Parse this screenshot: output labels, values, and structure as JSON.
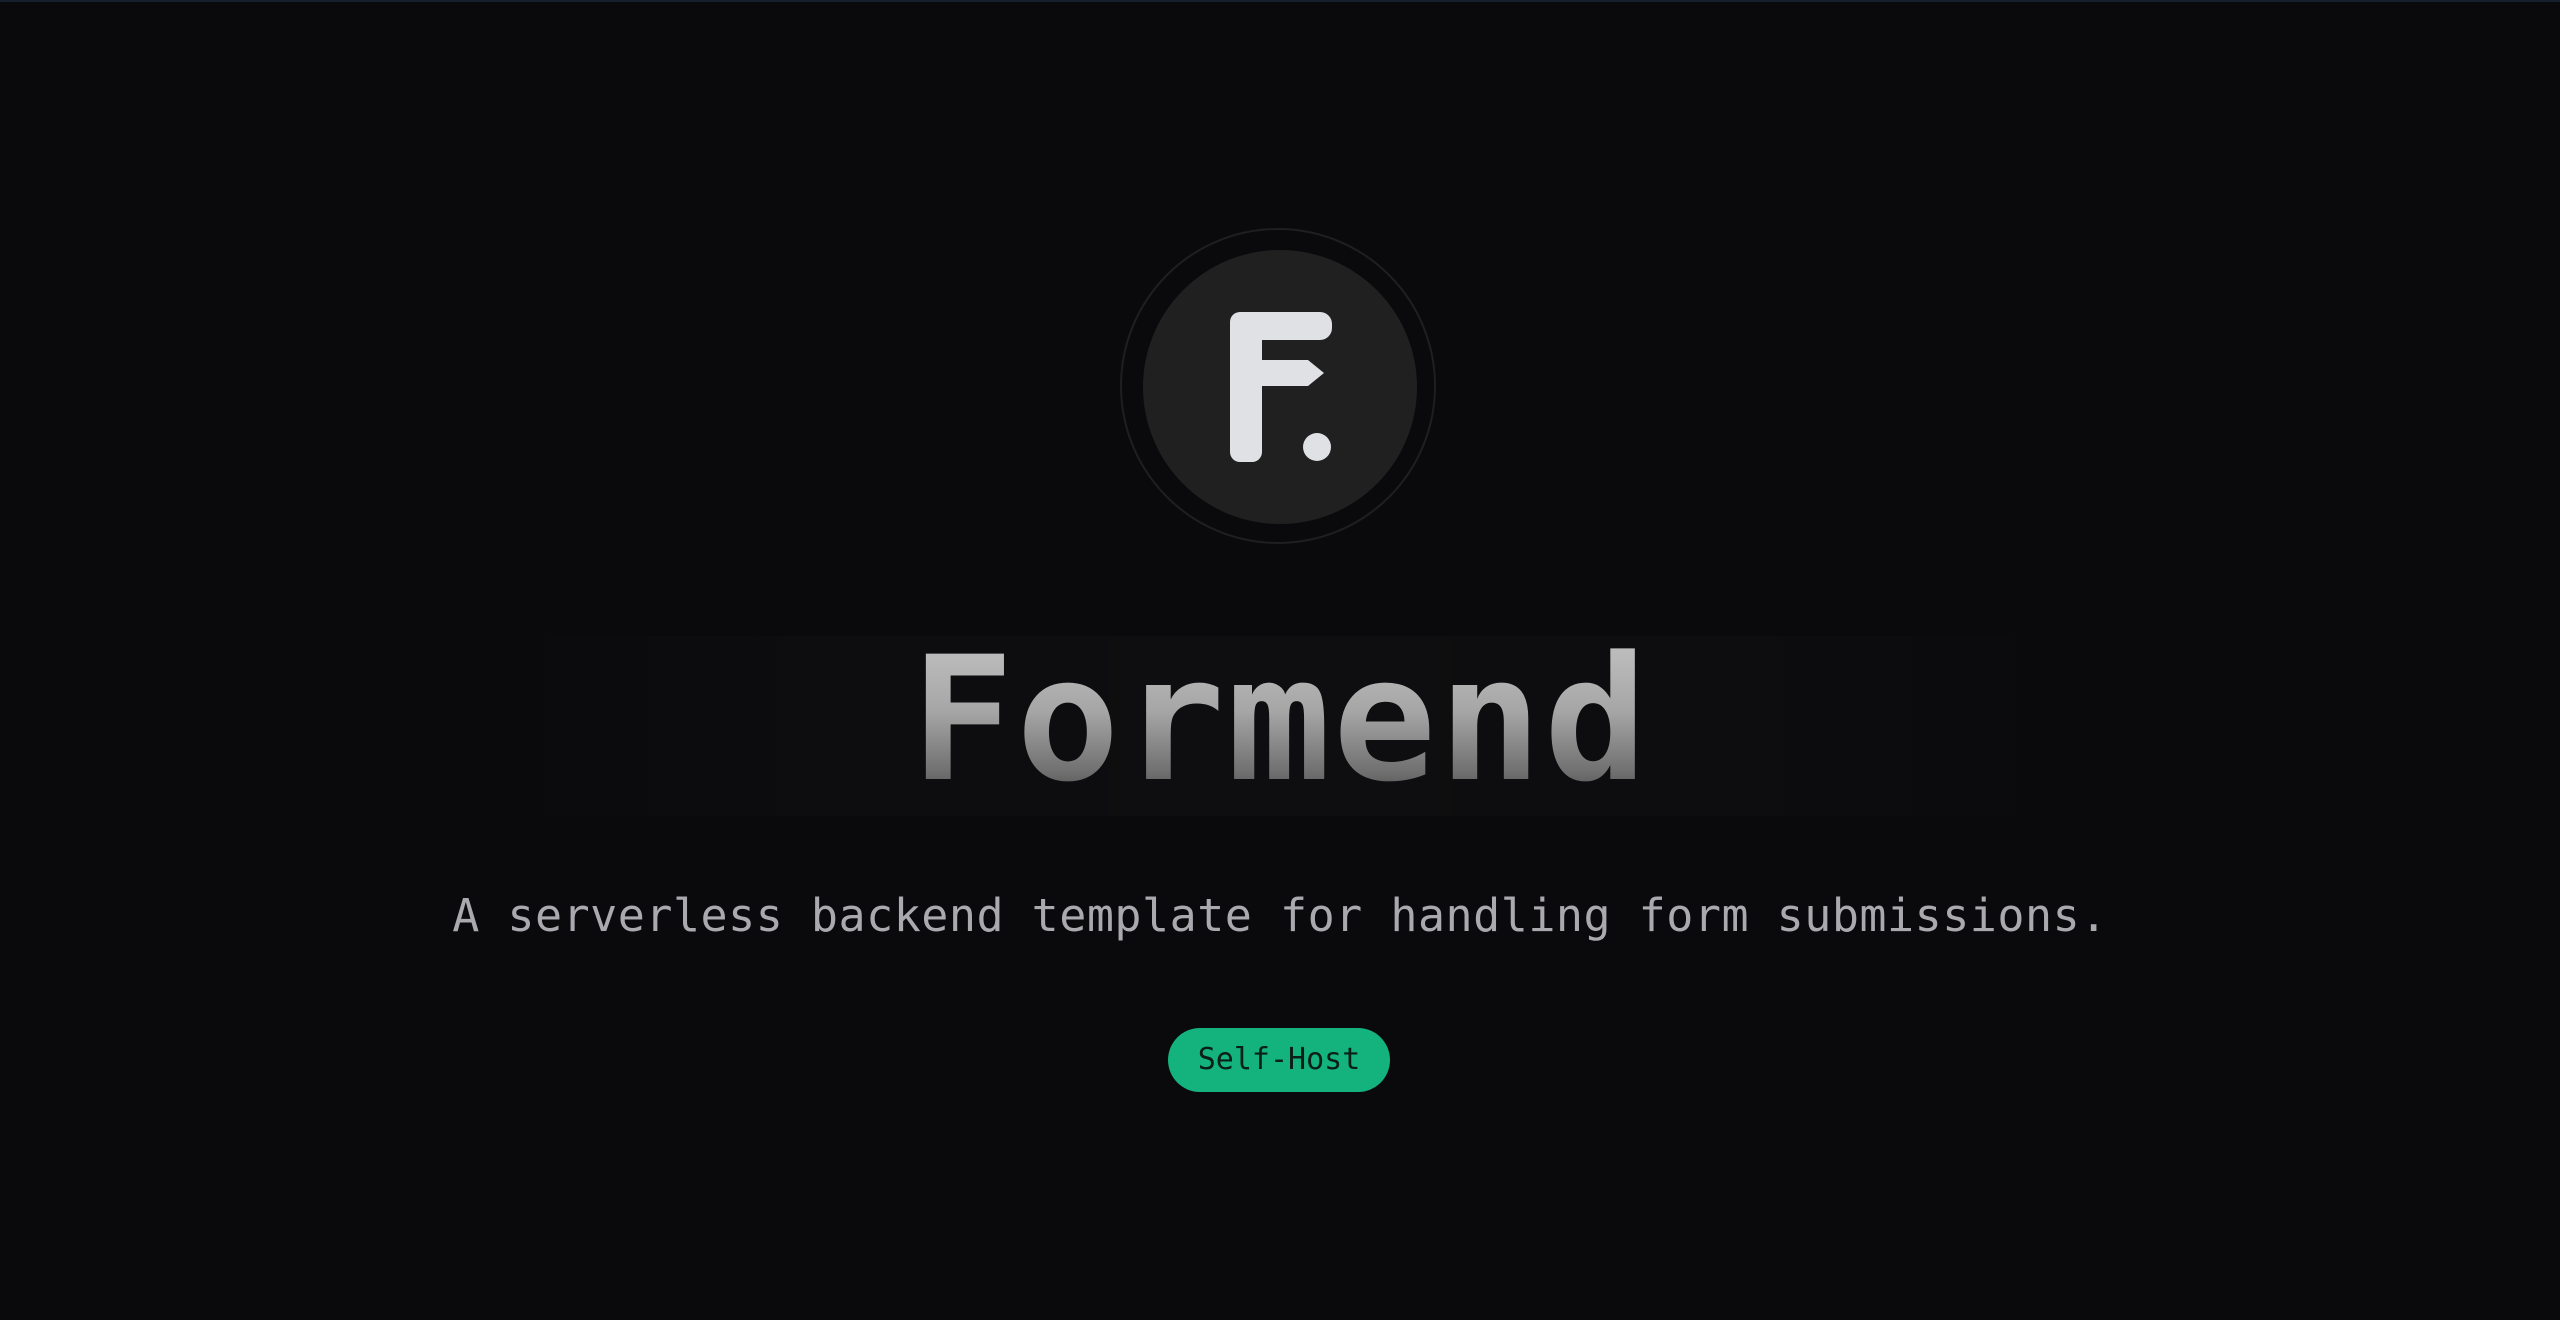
{
  "hero": {
    "logo_icon": "formend-f-logo-icon",
    "title": "Formend",
    "subtitle": "A serverless backend template for handling form submissions.",
    "cta_label": "Self-Host"
  },
  "colors": {
    "background": "#0a0a0c",
    "logo_disc": "#202021",
    "logo_glyph": "#dfe1e5",
    "accent_button": "#14b37d",
    "subtitle_text": "#a9a9ae"
  }
}
